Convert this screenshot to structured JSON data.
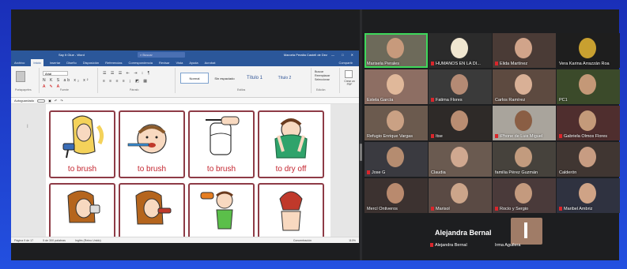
{
  "word": {
    "title": "Say It Glue - Word",
    "search": "Buscar",
    "user": "Marcela Peralta Castell de Dez",
    "window_controls": "— □ ✕",
    "menu": [
      "Archivo",
      "Inicio",
      "Insertar",
      "Diseño",
      "Disposición",
      "Referencias",
      "Correspondencia",
      "Revisar",
      "Vista",
      "Ayuda",
      "Acrobat"
    ],
    "active_menu_index": 1,
    "share_label": "Compartir",
    "font_name": "Arial",
    "styles": [
      "Normal",
      "Sin espaciado",
      "Título 1",
      "Título 2"
    ],
    "group_labels": [
      "Portapapeles",
      "Fuente",
      "Párrafo",
      "Estilos",
      "Edición",
      "Adobe Acrobat"
    ],
    "ribbon_right": [
      "Buscar",
      "Reemplazar",
      "Seleccionar",
      "Crear un PDF"
    ],
    "nav_text": "Autoguardado",
    "status": [
      "Página 9 de 17",
      "5 de 300 palabras",
      "Inglés (Reino Unido)"
    ],
    "status_right": "Concentración",
    "zoom": "110%",
    "cards_row1": [
      "to brush",
      "to brush",
      "to brush",
      "to dry off"
    ]
  },
  "gallery": {
    "tiles": [
      {
        "name": "Marisela Perales",
        "muted": false,
        "active": true
      },
      {
        "name": "HUMANOS EN LA DI...",
        "muted": true
      },
      {
        "name": "Elida Martínez",
        "muted": true
      },
      {
        "name": "Vera Karina Arrazzán Roa",
        "muted": false
      },
      {
        "name": "Estela García",
        "muted": false
      },
      {
        "name": "Fatima Flores",
        "muted": true
      },
      {
        "name": "Carlos Ramírez",
        "muted": false
      },
      {
        "name": "PC1",
        "muted": false
      },
      {
        "name": "Refugio Enrique Vargas",
        "muted": false
      },
      {
        "name": "Itse",
        "muted": true
      },
      {
        "name": "iPhone de Luis Miguel",
        "muted": true
      },
      {
        "name": "Gabriela Olmos Flores",
        "muted": true
      },
      {
        "name": "Jose G",
        "muted": true
      },
      {
        "name": "Claudia",
        "muted": false
      },
      {
        "name": "familia Pérez Guzmán",
        "muted": false
      },
      {
        "name": "Calderón",
        "muted": false
      },
      {
        "name": "Mercí Ontiveros",
        "muted": false
      },
      {
        "name": "Marisol",
        "muted": true
      },
      {
        "name": "Rocío y Sergio",
        "muted": true
      },
      {
        "name": "Maribel Ambriz",
        "muted": true
      }
    ],
    "speaker_name": "Alejandra Bernal",
    "bottom": [
      {
        "name": "Alejandra Bernal",
        "muted": true
      },
      {
        "name": "Irma Aguilera",
        "muted": false
      }
    ]
  },
  "colors": {
    "word_blue": "#2b579a",
    "card_border": "#8e3b46",
    "card_text": "#c4242e",
    "active_speaker": "#3ed85b",
    "mute_red": "#d9262c"
  }
}
